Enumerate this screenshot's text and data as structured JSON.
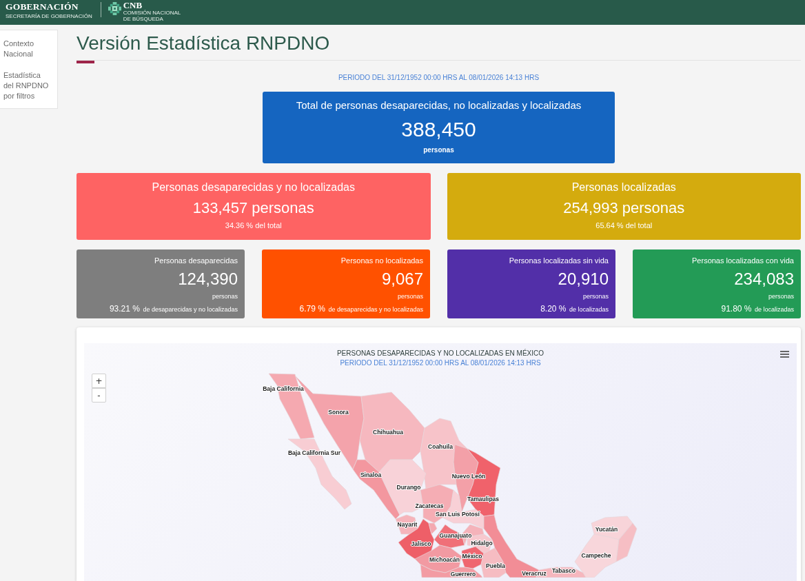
{
  "header": {
    "ministry": {
      "name": "GOBERNACIÓN",
      "subtitle": "SECRETARÍA DE GOBERNACIÓN"
    },
    "commission": {
      "name": "CNB",
      "subtitle": "COMISIÓN NACIONAL DE BÚSQUEDA"
    }
  },
  "sidebar": {
    "items": [
      {
        "label": "Contexto Nacional",
        "selected": false
      },
      {
        "label": "Estadística del RNPDNO por filtros",
        "selected": false
      }
    ]
  },
  "page": {
    "title": "Versión Estadística RNPDNO",
    "period": "PERIODO DEL 31/12/1952 00:00 HRS AL 08/01/2026 14:13 HRS"
  },
  "total_card": {
    "title": "Total de personas desaparecidas, no localizadas y localizadas",
    "value": "388,450",
    "unit": "personas"
  },
  "summary_cards": [
    {
      "title": "Personas desaparecidas y no localizadas",
      "value": "133,457 personas",
      "share": "34.36 % del total",
      "color": "#fe6363"
    },
    {
      "title": "Personas localizadas",
      "value": "254,993 personas",
      "share": "65.64 % del total",
      "color": "#d4ab0e"
    }
  ],
  "detail_cards": [
    {
      "title": "Personas desaparecidas",
      "value": "124,390",
      "unit": "personas",
      "percent": "93.21 %",
      "percent_of": "de desaparecidas y no localizadas",
      "color": "#7e7e7e"
    },
    {
      "title": "Personas no localizadas",
      "value": "9,067",
      "unit": "personas",
      "percent": "6.79 %",
      "percent_of": "de desaparecidas y no localizadas",
      "color": "#ff5100"
    },
    {
      "title": "Personas localizadas sin vida",
      "value": "20,910",
      "unit": "personas",
      "percent": "8.20 %",
      "percent_of": "de localizadas",
      "color": "#522fa8"
    },
    {
      "title": "Personas localizadas con vida",
      "value": "234,083",
      "unit": "personas",
      "percent": "91.80 %",
      "percent_of": "de localizadas",
      "color": "#239b56"
    }
  ],
  "map": {
    "title": "PERSONAS DESAPARECIDAS Y NO LOCALIZADAS EN MÉXICO",
    "subtitle": "PERIODO DEL 31/12/1952 00:00 HRS AL 08/01/2026 14:13 HRS",
    "zoom_in": "+",
    "zoom_out": "-",
    "regions": [
      {
        "label": "Baja California",
        "color": "#f5a9b0"
      },
      {
        "label": "Sonora",
        "color": "#f4a3ab"
      },
      {
        "label": "Chihuahua",
        "color": "#f6b8bf"
      },
      {
        "label": "Baja California Sur",
        "color": "#f8cdd3"
      },
      {
        "label": "Coahuila",
        "color": "#f7c3c9"
      },
      {
        "label": "Sinaloa",
        "color": "#f3979f"
      },
      {
        "label": "Nuevo León",
        "color": "#f3a0a8"
      },
      {
        "label": "Durango",
        "color": "#f8d2d8"
      },
      {
        "label": "Tamaulipas",
        "color": "#f0626b"
      },
      {
        "label": "Zacatecas",
        "color": "#f5adb4"
      },
      {
        "label": "San Luis Potosí",
        "color": "#f8d0d6"
      },
      {
        "label": "Nayarit",
        "color": "#f6b4bb"
      },
      {
        "label": "Guanajuato",
        "color": "#f07078"
      },
      {
        "label": "Yucatán",
        "color": "#f8d4d9"
      },
      {
        "label": "Jalisco",
        "color": "#ee5f68"
      },
      {
        "label": "Hidalgo",
        "color": "#f7c8ce"
      },
      {
        "label": "Campeche",
        "color": "#f8d6db"
      },
      {
        "label": "Michoacán",
        "color": "#f29aa2"
      },
      {
        "label": "México",
        "color": "#ef6670"
      },
      {
        "label": "Puebla",
        "color": "#f6bcc2"
      },
      {
        "label": "Guerrero",
        "color": "#f39ba3"
      },
      {
        "label": "Veracruz",
        "color": "#f28d96"
      },
      {
        "label": "Tabasco",
        "color": "#f6b7be"
      },
      {
        "color": "#f6bec4"
      },
      {
        "color": "#f5b3ba"
      },
      {
        "color": "#f4a8b0"
      }
    ]
  }
}
